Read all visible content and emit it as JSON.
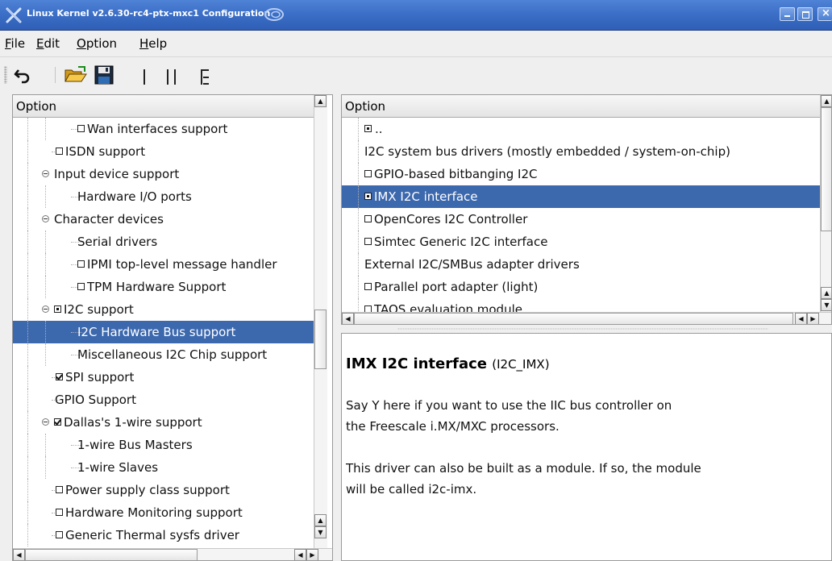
{
  "window": {
    "title": "Linux Kernel v2.6.30-rc4-ptx-mxc1 Configuration",
    "controls": [
      "minimize",
      "maximize",
      "close"
    ],
    "accent": "#3c68ae"
  },
  "menu": [
    {
      "label": "File",
      "mnemonic": "F",
      "rest": "ile"
    },
    {
      "label": "Edit",
      "mnemonic": "E",
      "rest": "dit"
    },
    {
      "label": "Option",
      "mnemonic": "O",
      "rest": "ption"
    },
    {
      "label": "Help",
      "mnemonic": "H",
      "rest": "elp"
    }
  ],
  "toolbar": {
    "icons": [
      "back-arrow-icon",
      "open-folder-icon",
      "save-disk-icon",
      "single-view-icon",
      "split-view-icon",
      "full-view-icon"
    ]
  },
  "left_tree": {
    "header": "Option",
    "rows": [
      {
        "label": "Wan interfaces support",
        "checkbox": "unchecked",
        "indent": 2
      },
      {
        "label": "ISDN support",
        "checkbox": "unchecked",
        "indent": 1
      },
      {
        "label": "Input device support",
        "expander": true,
        "indent": 0
      },
      {
        "label": "Hardware I/O ports",
        "indent": 2
      },
      {
        "label": "Character devices",
        "expander": true,
        "indent": 0
      },
      {
        "label": "Serial drivers",
        "indent": 2
      },
      {
        "label": "IPMI top-level message handler",
        "checkbox": "unchecked",
        "indent": 2
      },
      {
        "label": "TPM Hardware Support",
        "checkbox": "unchecked",
        "indent": 2
      },
      {
        "label": "I2C support",
        "checkbox": "module",
        "expander": true,
        "indent": 0
      },
      {
        "label": "I2C Hardware Bus support",
        "indent": 2,
        "selected": true
      },
      {
        "label": "Miscellaneous I2C Chip support",
        "indent": 2
      },
      {
        "label": "SPI support",
        "checkbox": "checked",
        "indent": 1
      },
      {
        "label": "GPIO Support",
        "indent": 1
      },
      {
        "label": "Dallas's 1-wire support",
        "checkbox": "checked",
        "expander": true,
        "indent": 0
      },
      {
        "label": "1-wire Bus Masters",
        "indent": 2
      },
      {
        "label": "1-wire Slaves",
        "indent": 2
      },
      {
        "label": "Power supply class support",
        "checkbox": "unchecked",
        "indent": 1
      },
      {
        "label": "Hardware Monitoring support",
        "checkbox": "unchecked",
        "indent": 1
      },
      {
        "label": "Generic Thermal sysfs driver",
        "checkbox": "unchecked",
        "indent": 1
      }
    ]
  },
  "right_list": {
    "header": "Option",
    "rows": [
      {
        "label": "..",
        "parent_icon": true
      },
      {
        "label": "I2C system bus drivers (mostly embedded / system-on-chip)"
      },
      {
        "label": "GPIO-based bitbanging I2C",
        "checkbox": "unchecked"
      },
      {
        "label": "IMX I2C interface",
        "checkbox": "module",
        "selected": true
      },
      {
        "label": "OpenCores I2C Controller",
        "checkbox": "unchecked"
      },
      {
        "label": "Simtec Generic I2C interface",
        "checkbox": "unchecked"
      },
      {
        "label": "External I2C/SMBus adapter drivers"
      },
      {
        "label": "Parallel port adapter (light)",
        "checkbox": "unchecked"
      },
      {
        "label": "TAOS evaluation module",
        "checkbox": "unchecked"
      }
    ]
  },
  "description": {
    "title": "IMX I2C interface",
    "symbol": "(I2C_IMX)",
    "lines": [
      "Say Y here if you want to use the IIC bus controller on",
      "the Freescale i.MX/MXC processors.",
      "",
      "This driver can also be built as a module.  If so, the module",
      "will be called i2c-imx."
    ]
  }
}
